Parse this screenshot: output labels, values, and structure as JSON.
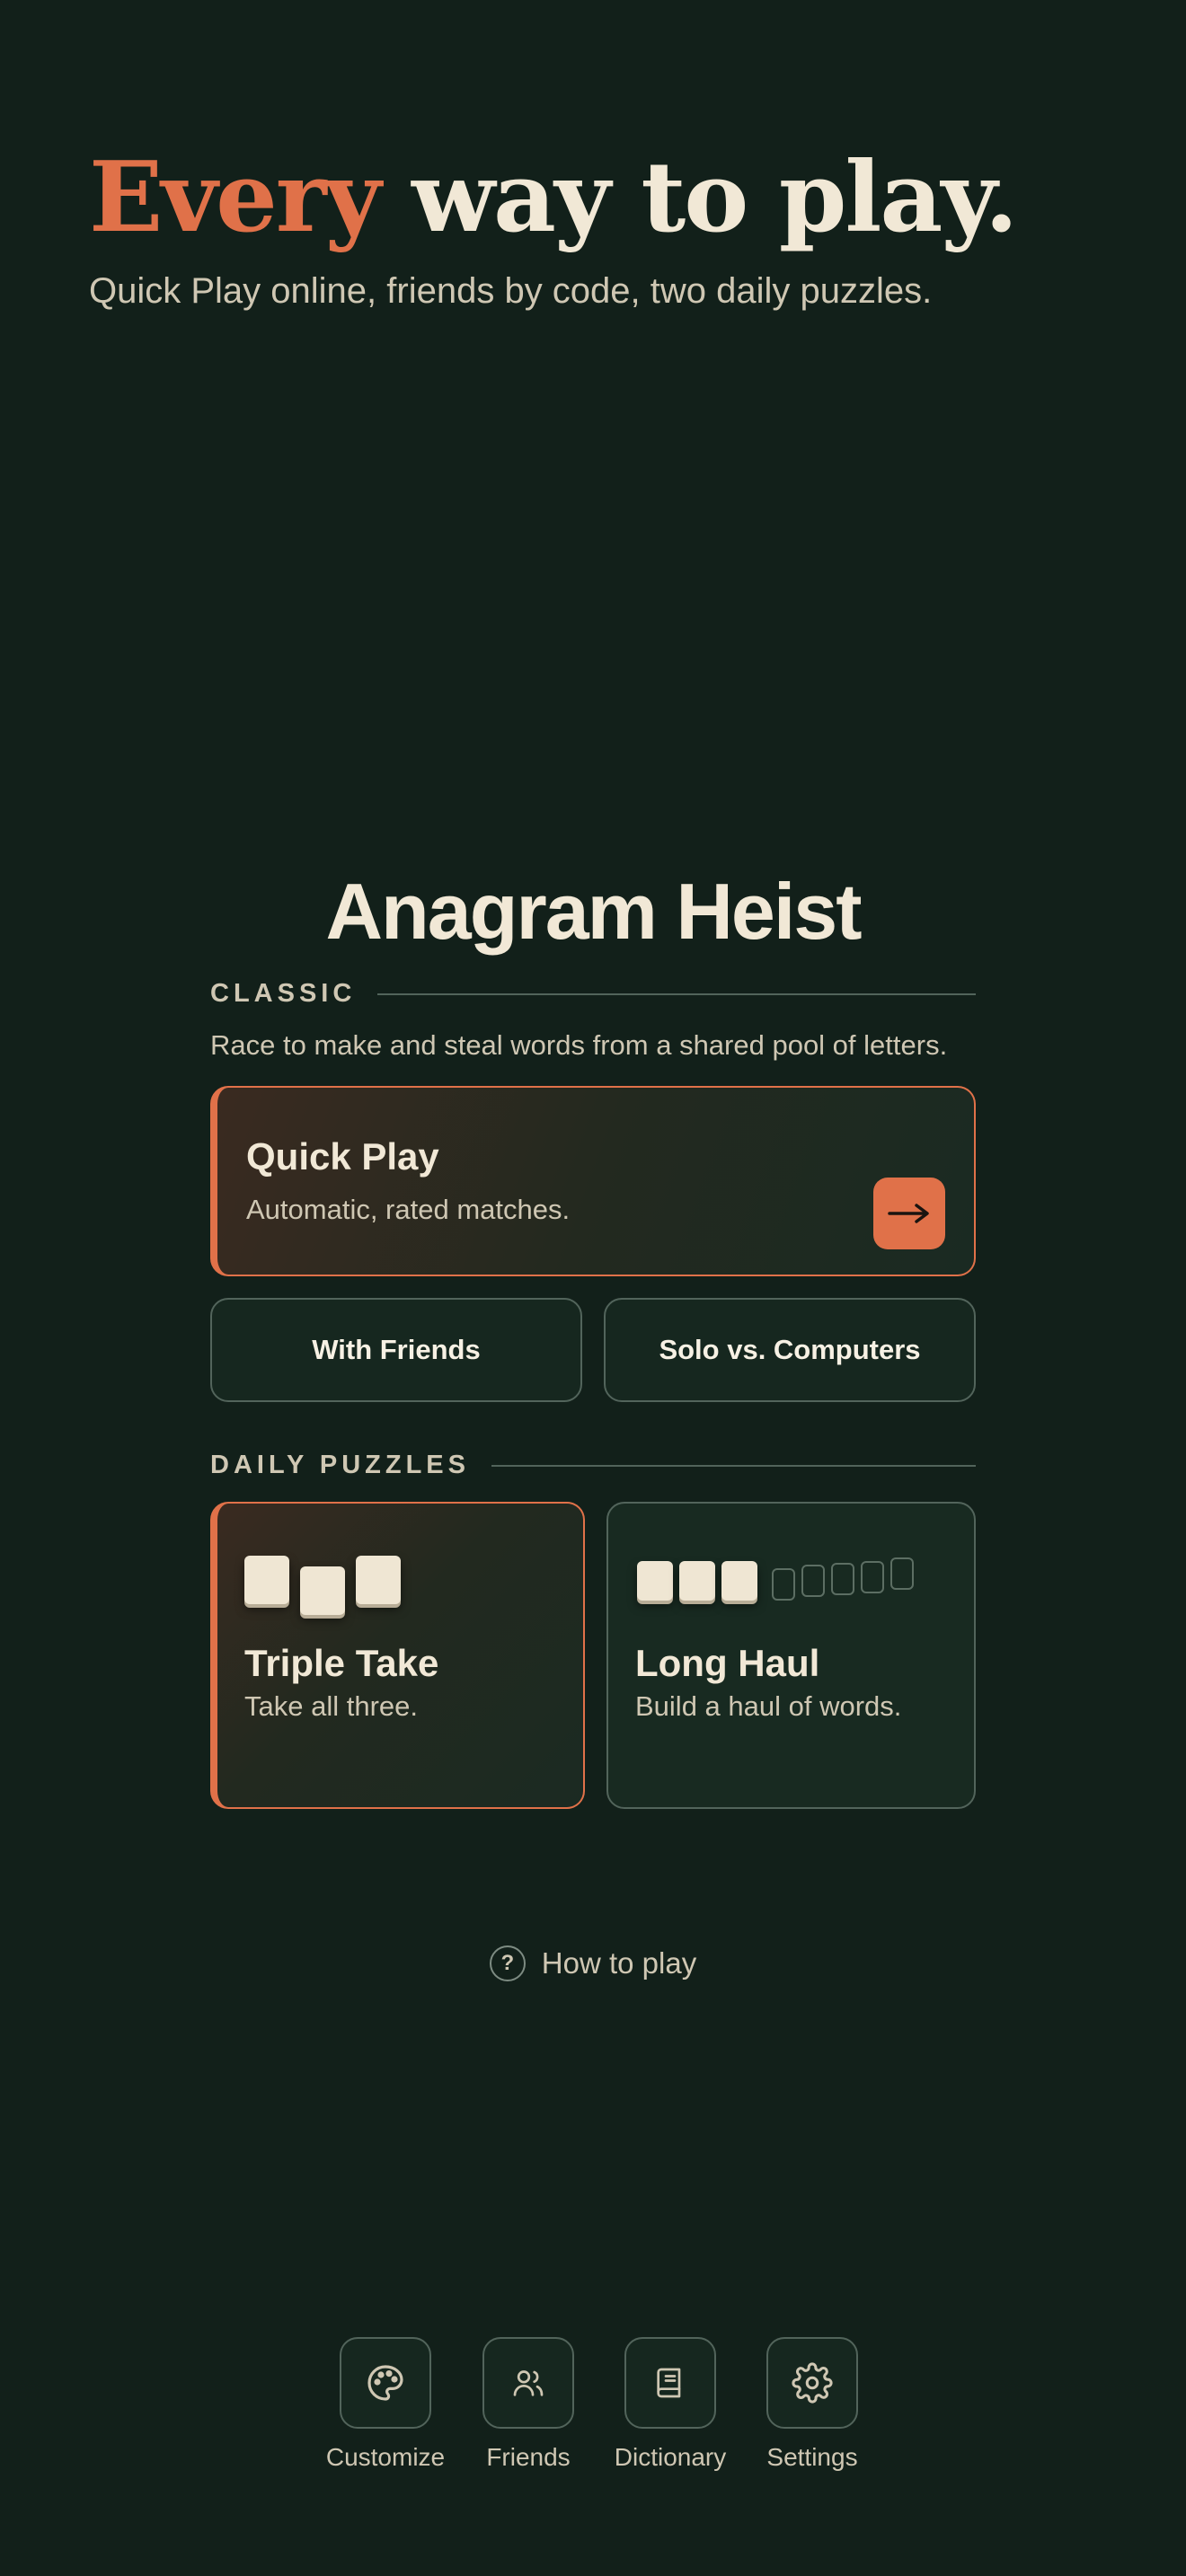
{
  "hero": {
    "title_accent": "Every",
    "title_rest": "way to play.",
    "subtitle": "Quick Play online, friends by code, two daily puzzles."
  },
  "app": {
    "title": "Anagram Heist"
  },
  "classic": {
    "heading": "CLASSIC",
    "description": "Race to make and steal words from a shared pool of letters.",
    "quick_play": {
      "title": "Quick Play",
      "subtitle": "Automatic, rated matches.",
      "icon": "arrow-right-icon"
    },
    "with_friends": "With Friends",
    "solo": "Solo vs. Computers"
  },
  "daily": {
    "heading": "DAILY PUZZLES",
    "triple_take": {
      "title": "Triple Take",
      "subtitle": "Take all three."
    },
    "long_haul": {
      "title": "Long Haul",
      "subtitle": "Build a haul of words."
    }
  },
  "how_to_play": {
    "icon": "question-icon",
    "label": "How to play"
  },
  "nav": [
    {
      "label": "Customize",
      "icon": "palette-icon"
    },
    {
      "label": "Friends",
      "icon": "users-icon"
    },
    {
      "label": "Dictionary",
      "icon": "book-icon"
    },
    {
      "label": "Settings",
      "icon": "gear-icon"
    }
  ],
  "colors": {
    "background": "#12201a",
    "accent": "#e07149",
    "cream": "#f1e8d6",
    "muted": "#cfc7b3",
    "border": "#52645b"
  }
}
